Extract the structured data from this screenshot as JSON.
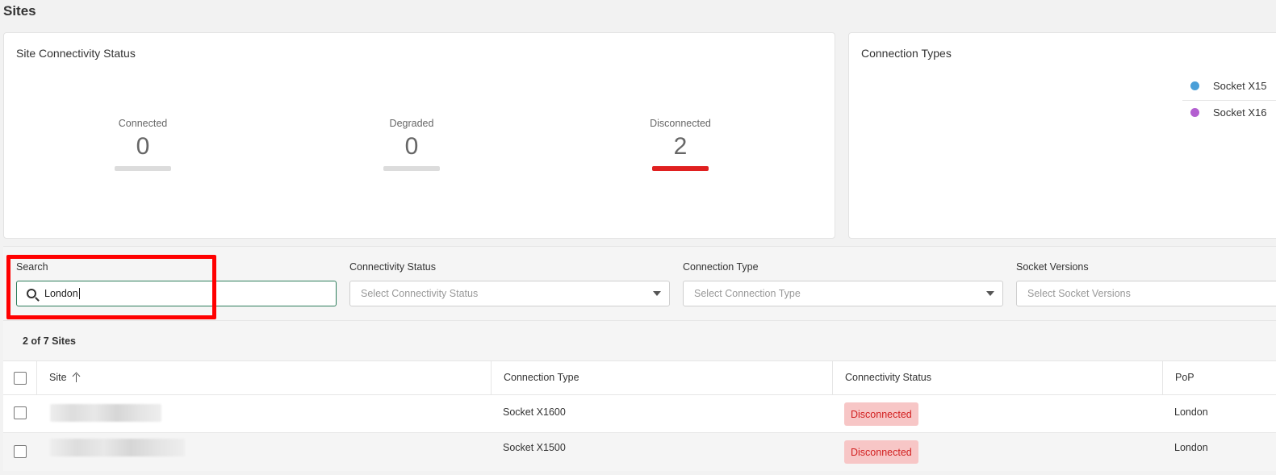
{
  "page": {
    "title": "Sites"
  },
  "connectivity_card": {
    "title": "Site Connectivity Status",
    "stats": [
      {
        "label": "Connected",
        "value": "0",
        "bar_color": "#dcdcdc"
      },
      {
        "label": "Degraded",
        "value": "0",
        "bar_color": "#dcdcdc"
      },
      {
        "label": "Disconnected",
        "value": "2",
        "bar_color": "#e02020"
      }
    ]
  },
  "types_card": {
    "title": "Connection Types",
    "legend": [
      {
        "label": "Socket X15",
        "color": "#4a9fd8"
      },
      {
        "label": "Socket X16",
        "color": "#b35fd0"
      }
    ]
  },
  "filters": {
    "search": {
      "label": "Search",
      "value": "London"
    },
    "connectivity_status": {
      "label": "Connectivity Status",
      "placeholder": "Select Connectivity Status"
    },
    "connection_type": {
      "label": "Connection Type",
      "placeholder": "Select Connection Type"
    },
    "socket_versions": {
      "label": "Socket Versions",
      "placeholder": "Select Socket Versions"
    }
  },
  "results": {
    "count_text": "2 of 7 Sites"
  },
  "table": {
    "columns": {
      "site": "Site",
      "connection_type": "Connection Type",
      "connectivity_status": "Connectivity Status",
      "pop": "PoP"
    },
    "rows": [
      {
        "connection_type": "Socket X1600",
        "status": "Disconnected",
        "pop": "London"
      },
      {
        "connection_type": "Socket X1500",
        "status": "Disconnected",
        "pop": "London"
      }
    ]
  },
  "colors": {
    "accent_focus": "#2e7d5b",
    "danger": "#d21f1f",
    "highlight": "#ff0000"
  }
}
